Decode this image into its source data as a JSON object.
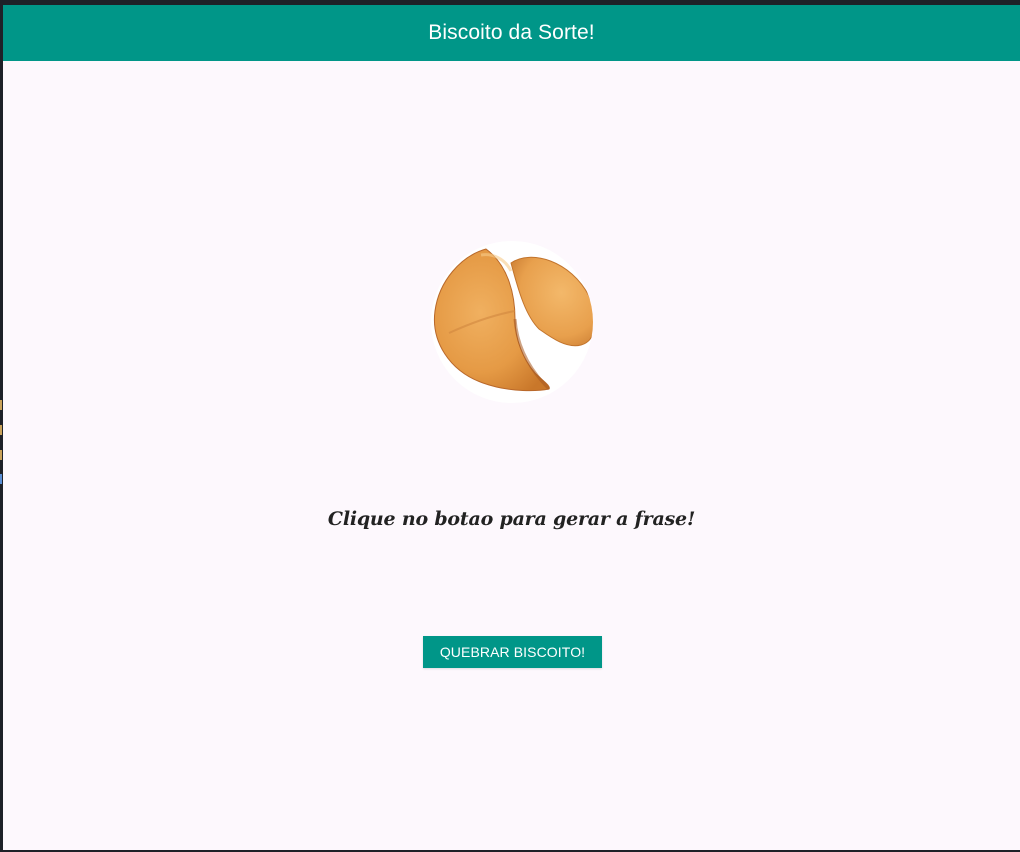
{
  "app": {
    "title": "Biscoito da Sorte!"
  },
  "colors": {
    "primary": "#009688",
    "background": "#fdf8fd",
    "text": "#222222"
  },
  "cookie": {
    "icon": "fortune-cookie-icon"
  },
  "phrase": {
    "text": "Clique no botao para gerar a frase!"
  },
  "button": {
    "label": "QUEBRAR BISCOITO!"
  }
}
